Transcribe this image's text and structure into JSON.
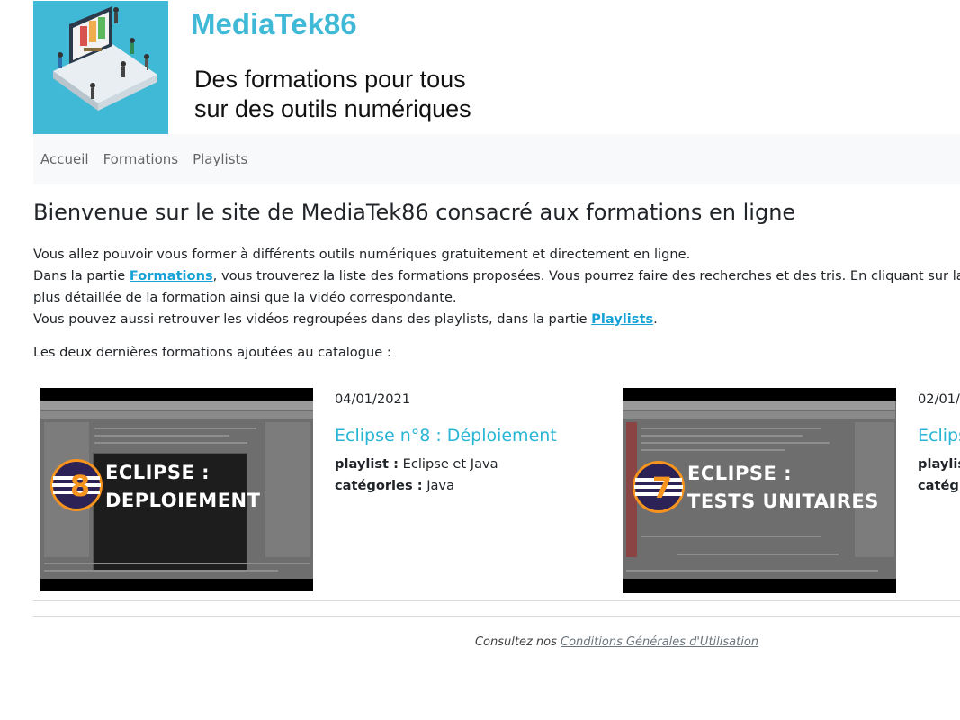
{
  "header": {
    "title": "MediaTek86",
    "tagline_line1": "Des formations pour tous",
    "tagline_line2": "sur des outils numériques",
    "logo_icon": "laptop-library-illustration-icon",
    "brand_color": "#3fb9d6"
  },
  "nav": {
    "items": [
      {
        "label": "Accueil"
      },
      {
        "label": "Formations"
      },
      {
        "label": "Playlists"
      }
    ]
  },
  "main": {
    "title": "Bienvenue sur le site de MediaTek86 consacré aux formations en ligne",
    "intro": {
      "line1": "Vous allez pouvoir vous former à différents outils numériques gratuitement et directement en ligne.",
      "line2_before": "Dans la partie ",
      "line2_link": "Formations",
      "line2_after": ", vous trouverez la liste des formations proposées. Vous pourrez faire des recherches et des tris. En cliquant sur la captur",
      "line3": "plus détaillée de la formation ainsi que la vidéo correspondante.",
      "line4_before": "Vous pouvez aussi retrouver les vidéos regroupées dans des playlists, dans la partie ",
      "line4_link": "Playlists",
      "line4_after": "."
    },
    "latest_label": "Les deux dernières formations ajoutées au catalogue :",
    "formations": [
      {
        "date": "04/01/2021",
        "title": "Eclipse n°8 : Déploiement",
        "playlist_label": "playlist :",
        "playlist": "Eclipse et Java",
        "categories_label": "catégories :",
        "categories": "Java",
        "thumb_number": "8",
        "thumb_line1": "ECLIPSE :",
        "thumb_line2": "DEPLOIEMENT"
      },
      {
        "date": "02/01/",
        "title": "Eclips",
        "playlist_label": "playlis",
        "playlist": "",
        "categories_label": "catég",
        "categories": "",
        "thumb_number": "7",
        "thumb_line1": "ECLIPSE :",
        "thumb_line2": "TESTS UNITAIRES"
      }
    ]
  },
  "footer": {
    "text": "Consultez nos",
    "link": "Conditions Générales d'Utilisation"
  }
}
